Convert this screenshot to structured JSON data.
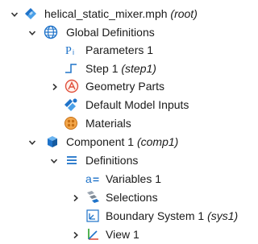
{
  "tree": {
    "root": {
      "label": "helical_static_mixer.mph",
      "tag": "(root)"
    },
    "global_definitions": {
      "label": "Global Definitions"
    },
    "parameters": {
      "label": "Parameters 1"
    },
    "step": {
      "label": "Step 1",
      "tag": "(step1)"
    },
    "geometry_parts": {
      "label": "Geometry Parts"
    },
    "default_model_inputs": {
      "label": "Default Model Inputs"
    },
    "materials": {
      "label": "Materials"
    },
    "component": {
      "label": "Component 1",
      "tag": "(comp1)"
    },
    "definitions": {
      "label": "Definitions"
    },
    "variables": {
      "label": "Variables 1"
    },
    "selections": {
      "label": "Selections"
    },
    "boundary_system": {
      "label": "Boundary System 1",
      "tag": "(sys1)"
    },
    "view": {
      "label": "View 1"
    }
  },
  "icons": {
    "chevron_expanded": "chevron-down-icon",
    "chevron_collapsed": "chevron-right-icon",
    "root": "model-root-icon",
    "global_definitions": "globe-icon",
    "parameters": "parameters-pi-icon",
    "step": "step-function-icon",
    "geometry_parts": "geometry-parts-icon",
    "default_model_inputs": "model-inputs-icon",
    "materials": "materials-icon",
    "component": "component-cube-icon",
    "definitions": "definitions-list-icon",
    "variables": "variables-icon",
    "selections": "selections-icon",
    "boundary_system": "boundary-system-icon",
    "view": "view-axes-icon"
  },
  "colors": {
    "blue": "#1f73c9",
    "orange": "#e8892a",
    "red_orange": "#e0503c",
    "text": "#1a1a1a"
  }
}
